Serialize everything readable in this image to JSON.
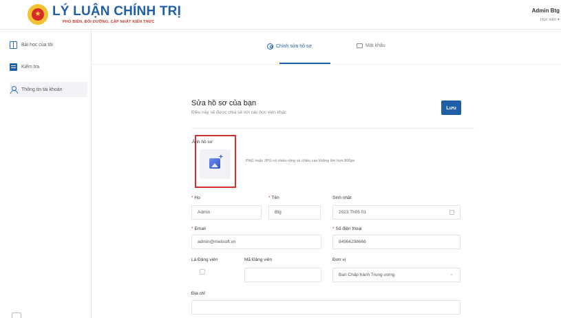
{
  "header": {
    "brand_title": "LÝ LUẬN CHÍNH TRỊ",
    "brand_subtitle": "PHỔ BIẾN, BỒI DƯỠNG, CẬP NHẬT KIẾN THỨC",
    "user_name": "Admin Btg",
    "user_role": "Học viên ▾"
  },
  "sidebar": {
    "items": [
      {
        "label": "Bài học của tôi",
        "icon": "book-icon"
      },
      {
        "label": "Kiểm tra",
        "icon": "test-icon"
      },
      {
        "label": "Thông tin tài khoản",
        "icon": "user-icon",
        "active": true
      }
    ]
  },
  "tabs": {
    "edit_profile": "Chỉnh sửa hồ sơ",
    "password": "Mật khẩu"
  },
  "form": {
    "title": "Sửa hồ sơ của bạn",
    "subtitle": "Điều này sẽ được chia sẻ với các học viên khác",
    "save_label": "Lưu",
    "avatar_label": "Ảnh hồ sơ",
    "avatar_note": "PNG hoặc JPG có chiều rộng và chiều cao không lớn hơn 800px",
    "req_mark": "*",
    "fields": {
      "last_name": {
        "label": "Họ",
        "value": "Admin"
      },
      "first_name": {
        "label": "Tên",
        "value": "Btg"
      },
      "birthday": {
        "label": "Sinh nhật",
        "value": "2023 Th05 01"
      },
      "email": {
        "label": "Email",
        "value": "admin@melisoft.vn"
      },
      "phone": {
        "label": "Số điện thoại",
        "value": "84966298666"
      },
      "party_member": {
        "label": "Là Đảng viên"
      },
      "party_code": {
        "label": "Mã Đảng viên",
        "value": ""
      },
      "unit": {
        "label": "Đơn vị",
        "value": "Ban Chấp hành Trung ương"
      },
      "address": {
        "label": "Địa chỉ",
        "value": ""
      }
    }
  },
  "colors": {
    "primary": "#1f5fa8",
    "brand_red": "#d43030",
    "highlight_border": "#d0302c"
  }
}
